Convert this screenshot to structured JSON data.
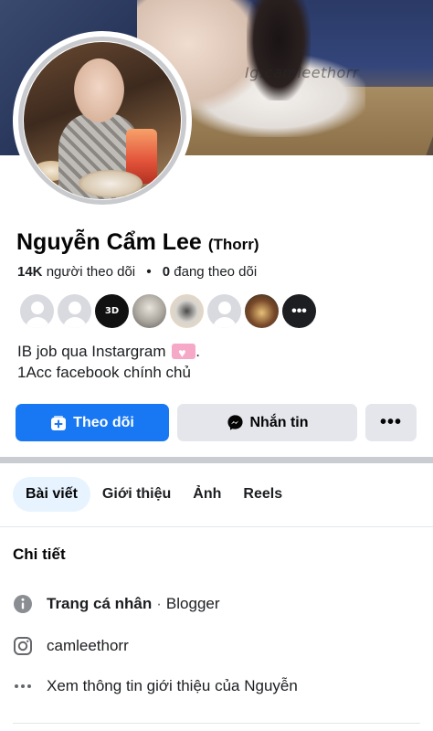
{
  "cover": {
    "watermark": "Ig:camleethorr"
  },
  "profile": {
    "name": "Nguyễn Cẩm Lee",
    "nickname": "(Thorr)",
    "followers_count": "14K",
    "followers_label": "người theo dõi",
    "following_count": "0",
    "following_label": "đang theo dõi",
    "bio_line1": "IB job qua Instargram",
    "bio_line2": "1Acc facebook chính chủ"
  },
  "friends": {
    "badge_text": "3D"
  },
  "actions": {
    "follow_label": "Theo dõi",
    "message_label": "Nhắn tin"
  },
  "tabs": [
    {
      "label": "Bài viết"
    },
    {
      "label": "Giới thiệu"
    },
    {
      "label": "Ảnh"
    },
    {
      "label": "Reels"
    }
  ],
  "details": {
    "title": "Chi tiết",
    "page_label": "Trang cá nhân",
    "page_category": "Blogger",
    "instagram": "camleethorr",
    "see_more": "Xem thông tin giới thiệu của Nguyễn"
  },
  "colors": {
    "accent": "#1877f2",
    "secondary_button": "#e4e6eb",
    "active_tab_bg": "#e7f3ff"
  }
}
